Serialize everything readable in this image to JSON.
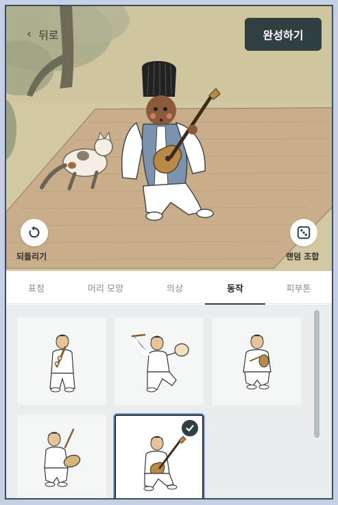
{
  "header": {
    "back_label": "뒤로",
    "done_label": "완성하기"
  },
  "scene_controls": {
    "undo_label": "되돌리기",
    "random_label": "랜덤 조합"
  },
  "tabs": [
    {
      "label": "표정",
      "active": false
    },
    {
      "label": "머리 모양",
      "active": false
    },
    {
      "label": "의상",
      "active": false
    },
    {
      "label": "동작",
      "active": true
    },
    {
      "label": "피부톤",
      "active": false
    }
  ],
  "poses": [
    {
      "pose": "flute-player",
      "selected": false
    },
    {
      "pose": "hand-drum-dancer",
      "selected": false
    },
    {
      "pose": "small-drum-player",
      "selected": false
    },
    {
      "pose": "janggu-drummer",
      "selected": false
    },
    {
      "pose": "guitar-player",
      "selected": true
    }
  ],
  "colors": {
    "accent": "#2f3f42",
    "scene_ground": "#d1c59f",
    "mat": "#c9ad8a",
    "robe_vest": "#7c93b0"
  },
  "icons": {
    "back": "chevron-left-icon",
    "undo": "rotate-ccw-icon",
    "random": "dice-icon",
    "check": "checkmark-icon"
  }
}
